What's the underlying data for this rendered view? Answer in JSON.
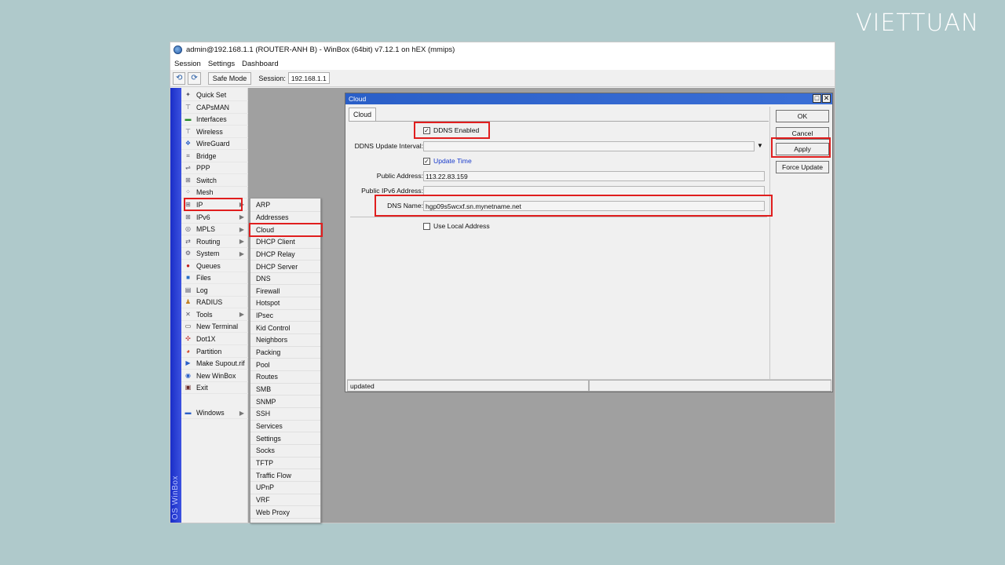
{
  "brand": {
    "logo_text": "VIETTUAN"
  },
  "window": {
    "title": "admin@192.168.1.1 (ROUTER-ANH B) - WinBox (64bit) v7.12.1 on hEX (mmips)",
    "menu": [
      "Session",
      "Settings",
      "Dashboard"
    ],
    "toolbar": {
      "undo_icon": "undo-icon",
      "redo_icon": "redo-icon",
      "safe_mode_label": "Safe Mode",
      "session_label": "Session:",
      "session_value": "192.168.1.1"
    },
    "sidebar_caption": "OS WinBox"
  },
  "sidebar": {
    "items": [
      {
        "label": "Quick Set",
        "icon": "wand-icon"
      },
      {
        "label": "CAPsMAN",
        "icon": "antenna-icon"
      },
      {
        "label": "Interfaces",
        "icon": "interface-icon"
      },
      {
        "label": "Wireless",
        "icon": "antenna-icon"
      },
      {
        "label": "WireGuard",
        "icon": "dragon-icon"
      },
      {
        "label": "Bridge",
        "icon": "bridge-icon"
      },
      {
        "label": "PPP",
        "icon": "ppp-icon"
      },
      {
        "label": "Switch",
        "icon": "switch-icon"
      },
      {
        "label": "Mesh",
        "icon": "mesh-icon"
      },
      {
        "label": "IP",
        "icon": "ip-icon",
        "submenu": true
      },
      {
        "label": "IPv6",
        "icon": "ipv6-icon",
        "submenu": true
      },
      {
        "label": "MPLS",
        "icon": "mpls-icon",
        "submenu": true
      },
      {
        "label": "Routing",
        "icon": "routing-icon",
        "submenu": true
      },
      {
        "label": "System",
        "icon": "gear-icon",
        "submenu": true
      },
      {
        "label": "Queues",
        "icon": "queue-icon"
      },
      {
        "label": "Files",
        "icon": "folder-icon"
      },
      {
        "label": "Log",
        "icon": "log-icon"
      },
      {
        "label": "RADIUS",
        "icon": "users-icon"
      },
      {
        "label": "Tools",
        "icon": "tools-icon",
        "submenu": true
      },
      {
        "label": "New Terminal",
        "icon": "terminal-icon"
      },
      {
        "label": "Dot1X",
        "icon": "dot1x-icon"
      },
      {
        "label": "Partition",
        "icon": "pie-icon"
      },
      {
        "label": "Make Supout.rif",
        "icon": "supout-icon"
      },
      {
        "label": "New WinBox",
        "icon": "winbox-icon"
      },
      {
        "label": "Exit",
        "icon": "exit-icon"
      },
      {
        "label": "Windows",
        "icon": "windows-icon",
        "submenu": true
      }
    ]
  },
  "ip_submenu": {
    "items": [
      "ARP",
      "Addresses",
      "Cloud",
      "DHCP Client",
      "DHCP Relay",
      "DHCP Server",
      "DNS",
      "Firewall",
      "Hotspot",
      "IPsec",
      "Kid Control",
      "Neighbors",
      "Packing",
      "Pool",
      "Routes",
      "SMB",
      "SNMP",
      "SSH",
      "Services",
      "Settings",
      "Socks",
      "TFTP",
      "Traffic Flow",
      "UPnP",
      "VRF",
      "Web Proxy"
    ]
  },
  "cloud_dialog": {
    "title": "Cloud",
    "tab": "Cloud",
    "ddns_enabled_label": "DDNS Enabled",
    "ddns_enabled": true,
    "ddns_interval_label": "DDNS Update Interval:",
    "ddns_interval_value": "",
    "update_time_label": "Update Time",
    "update_time": true,
    "public_address_label": "Public Address:",
    "public_address": "113.22.83.159",
    "public_ipv6_label": "Public IPv6 Address:",
    "public_ipv6": "",
    "dns_name_label": "DNS Name:",
    "dns_name": "hgp09s5wcxf.sn.mynetname.net",
    "use_local_label": "Use Local Address",
    "use_local": false,
    "buttons": {
      "ok": "OK",
      "cancel": "Cancel",
      "apply": "Apply",
      "force_update": "Force Update"
    },
    "status": "updated"
  },
  "colors": {
    "highlight": "#e01e1e",
    "title_bar": "#2a5fc8",
    "background": "#afc9cb",
    "link": "#1a3ccc"
  }
}
